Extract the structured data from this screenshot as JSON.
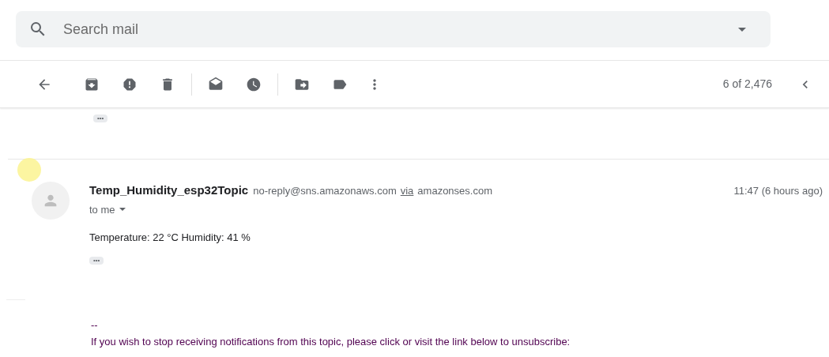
{
  "search": {
    "placeholder": "Search mail"
  },
  "toolbar": {
    "counter": "6 of 2,476"
  },
  "collapsed_marker_top": "•••",
  "message": {
    "sender_name": "Temp_Humidity_esp32Topic",
    "sender_email": "no-reply@sns.amazonaws.com",
    "via_label": "via",
    "via_domain": "amazonses.com",
    "time": "11:47 (6 hours ago)",
    "recipient": "to me",
    "body": "Temperature: 22 °C Humidity: 41 %",
    "collapsed_marker": "•••"
  },
  "footer": {
    "separator": "--",
    "notice": "If you wish to stop receiving notifications from this topic, please click or visit the link below to unsubscribe:"
  }
}
